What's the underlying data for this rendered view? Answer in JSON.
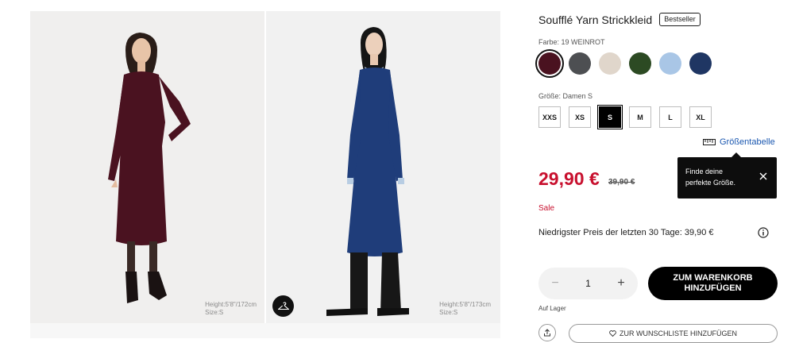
{
  "gallery": {
    "photos": [
      {
        "model_info_line1": "Height:5'8\"/172cm",
        "model_info_line2": "Size:S"
      },
      {
        "model_info_line1": "Height:5'8\"/173cm",
        "model_info_line2": "Size:S"
      }
    ],
    "hanger_icon": "hanger-icon"
  },
  "product": {
    "title": "Soufflé Yarn Strickkleid",
    "badge": "Bestseller"
  },
  "color": {
    "label": "Farbe: 19 WEINROT",
    "swatches": [
      "#4a1220",
      "#4d4f52",
      "#e0d6cb",
      "#2c4a23",
      "#a9c6e6",
      "#1f3663"
    ],
    "selected_index": 0
  },
  "size": {
    "label": "Größe: Damen S",
    "options": [
      "XXS",
      "XS",
      "S",
      "M",
      "L",
      "XL"
    ],
    "selected_index": 2,
    "chart_link": "Größentabelle"
  },
  "tooltip": {
    "line1": "Finde deine",
    "line2": "perfekte Größe."
  },
  "pricing": {
    "price": "29,90 €",
    "old_price": "39,90 €",
    "sale": "Sale",
    "lowest_price": "Niedrigster Preis der letzten 30 Tage: 39,90 €"
  },
  "cart": {
    "quantity": "1",
    "minus": "−",
    "plus": "+",
    "button_line1": "ZUM WARENKORB",
    "button_line2": "HINZUFÜGEN",
    "stock": "Auf Lager",
    "wishlist": "ZUR WUNSCHLISTE HINZUFÜGEN"
  },
  "colors": {
    "sale_red": "#c8102e",
    "link_blue": "#1a57b0"
  }
}
